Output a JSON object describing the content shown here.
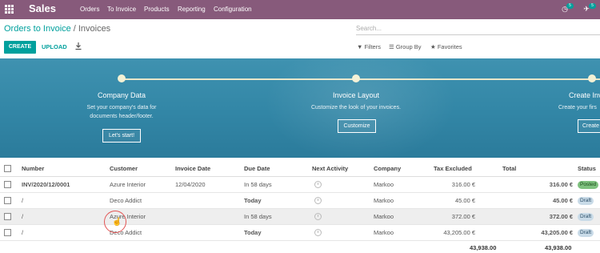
{
  "topbar": {
    "app_name": "Sales",
    "menu": [
      "Orders",
      "To Invoice",
      "Products",
      "Reporting",
      "Configuration"
    ],
    "activity_count": "5",
    "messages_count": "5"
  },
  "breadcrumb": {
    "parent": "Orders to Invoice",
    "separator": "/",
    "current": "Invoices"
  },
  "search": {
    "placeholder": "Search..."
  },
  "controls": {
    "create_label": "CREATE",
    "upload_label": "UPLOAD",
    "filters_label": "Filters",
    "groupby_label": "Group By",
    "favorites_label": "Favorites"
  },
  "onboarding": {
    "steps": [
      {
        "title": "Company Data",
        "desc1": "Set your company's data for",
        "desc2": "documents header/footer.",
        "button": "Let's start!"
      },
      {
        "title": "Invoice Layout",
        "desc1": "Customize the look of your invoices.",
        "desc2": "",
        "button": "Customize"
      },
      {
        "title": "Create Inv",
        "desc1": "Create your firs",
        "desc2": "",
        "button": "Create"
      }
    ]
  },
  "table": {
    "headers": {
      "number": "Number",
      "customer": "Customer",
      "invoice_date": "Invoice Date",
      "due_date": "Due Date",
      "next_activity": "Next Activity",
      "company": "Company",
      "tax_excluded": "Tax Excluded",
      "total": "Total",
      "status": "Status"
    },
    "rows": [
      {
        "number": "INV/2020/12/0001",
        "customer": "Azure Interior",
        "invoice_date": "12/04/2020",
        "due_date": "In 58 days",
        "company": "Markoo",
        "tax_excluded": "316.00 €",
        "total": "316.00 €",
        "status": "Posted"
      },
      {
        "number": "/",
        "customer": "Deco Addict",
        "invoice_date": "",
        "due_date": "Today",
        "company": "Markoo",
        "tax_excluded": "45.00 €",
        "total": "45.00 €",
        "status": "Draft"
      },
      {
        "number": "/",
        "customer": "Azure Interior",
        "invoice_date": "",
        "due_date": "In 58 days",
        "company": "Markoo",
        "tax_excluded": "372.00 €",
        "total": "372.00 €",
        "status": "Draft"
      },
      {
        "number": "/",
        "customer": "Deco Addict",
        "invoice_date": "",
        "due_date": "Today",
        "company": "Markoo",
        "tax_excluded": "43,205.00 €",
        "total": "43,205.00 €",
        "status": "Draft"
      }
    ],
    "totals": {
      "tax_excluded": "43,938.00",
      "total": "43,938.00"
    }
  },
  "colors": {
    "brand": "#875a7b",
    "accent": "#00a09d",
    "today": "#e6913c"
  }
}
